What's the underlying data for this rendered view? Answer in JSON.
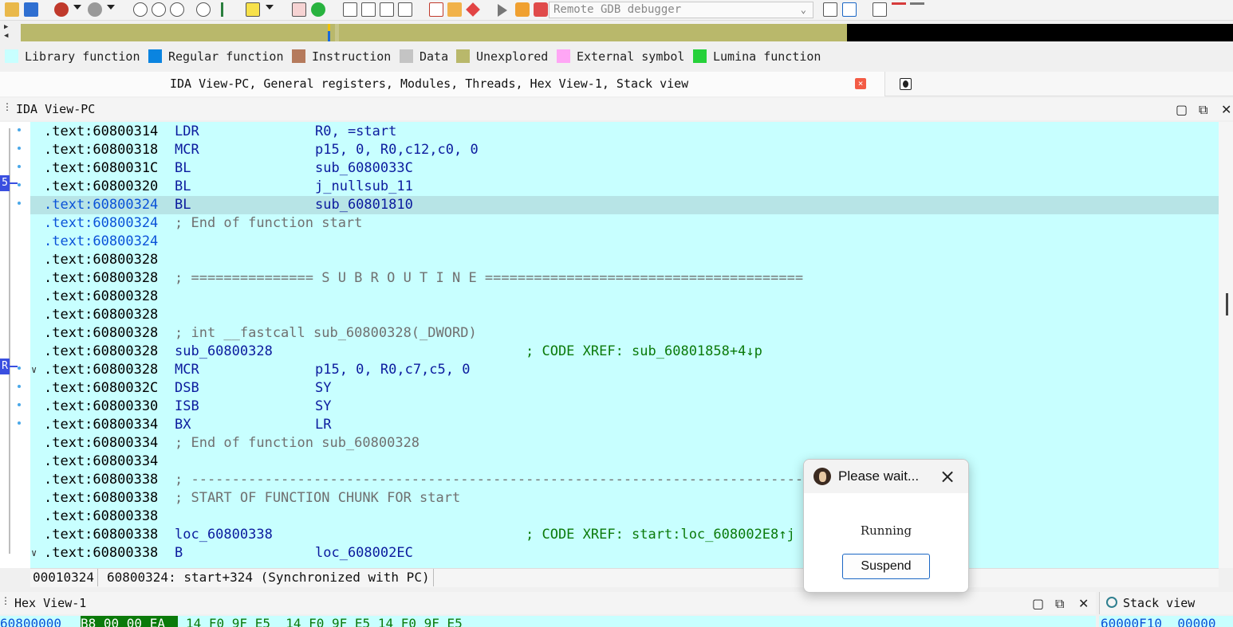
{
  "toolbar": {
    "icons": [
      "open-icon",
      "save-icon",
      "breakpoint-icon",
      "dropdown-icon",
      "bug-icon",
      "dropdown-icon",
      "nav-back-icon",
      "nav-forward-icon",
      "nav-up-icon",
      "jump-icon",
      "jump-to-icon",
      "text-icon",
      "dropdown-icon",
      "debug-stop-icon",
      "debug-go-icon"
    ],
    "debugger_select": "Remote GDB debugger"
  },
  "legend": [
    {
      "label": "Library function",
      "color": "#c8ffff"
    },
    {
      "label": "Regular function",
      "color": "#0a84e0"
    },
    {
      "label": "Instruction",
      "color": "#b57a5c"
    },
    {
      "label": "Data",
      "color": "#c4c4c4"
    },
    {
      "label": "Unexplored",
      "color": "#b9b86b"
    },
    {
      "label": "External symbol",
      "color": "#ffa6f5"
    },
    {
      "label": "Lumina function",
      "color": "#26d13a"
    }
  ],
  "tabs": {
    "active_title": "IDA View-PC, General registers, Modules, Threads, Hex View-1, Stack view",
    "close_glyph": "×"
  },
  "idaview": {
    "title": "IDA View-PC",
    "gutter_markers": [
      "5",
      "R"
    ]
  },
  "disasm": {
    "lines": [
      {
        "addr": ".text:60800314",
        "mn": "LDR",
        "op": "R0, =start"
      },
      {
        "addr": ".text:60800318",
        "mn": "MCR",
        "op": "p15, 0, R0,c12,c0, 0"
      },
      {
        "addr": ".text:6080031C",
        "mn": "BL",
        "op": "sub_6080033C"
      },
      {
        "addr": ".text:60800320",
        "mn": "BL",
        "op": "j_nullsub_11"
      },
      {
        "addr": ".text:60800324",
        "mn": "BL",
        "op": "sub_60801810"
      },
      {
        "addr": ".text:60800324",
        "cm": "; End of function start"
      },
      {
        "addr": ".text:60800324"
      },
      {
        "addr": ".text:60800328"
      },
      {
        "addr": ".text:60800328",
        "cm": "; =============== S U B R O U T I N E ======================================="
      },
      {
        "addr": ".text:60800328"
      },
      {
        "addr": ".text:60800328"
      },
      {
        "addr": ".text:60800328",
        "cm": "; int __fastcall sub_60800328(_DWORD)"
      },
      {
        "addr": ".text:60800328",
        "mn": "sub_60800328",
        "xr": "; CODE XREF: sub_60801858+4↓p"
      },
      {
        "addr": ".text:60800328",
        "mn": "MCR",
        "op": "p15, 0, R0,c7,c5, 0"
      },
      {
        "addr": ".text:6080032C",
        "mn": "DSB",
        "op": "SY"
      },
      {
        "addr": ".text:60800330",
        "mn": "ISB",
        "op": "SY"
      },
      {
        "addr": ".text:60800334",
        "mn": "BX",
        "op": "LR"
      },
      {
        "addr": ".text:60800334",
        "cm": "; End of function sub_60800328"
      },
      {
        "addr": ".text:60800334"
      },
      {
        "addr": ".text:60800338",
        "cm": "; ---------------------------------------------------------------------------"
      },
      {
        "addr": ".text:60800338",
        "cm": "; START OF FUNCTION CHUNK FOR start"
      },
      {
        "addr": ".text:60800338"
      },
      {
        "addr": ".text:60800338",
        "mn": "loc_60800338",
        "xr": "; CODE XREF: start:loc_608002E8↑j"
      },
      {
        "addr": ".text:60800338",
        "mn": "B",
        "op": "loc_608002EC"
      }
    ]
  },
  "status": {
    "offset": "00010324",
    "location": "60800324: start+324 (Synchronized with PC)"
  },
  "hexview": {
    "title": "Hex View-1",
    "addr": "60800000",
    "highlight": "B8 00 00 EA",
    "bytes": "14 F0 9F E5  14 F0 9F E5 14 F0 9F E5"
  },
  "stackview": {
    "title": "Stack view",
    "row": "60000F10  00000"
  },
  "dialog": {
    "title": "Please wait...",
    "message": "Running",
    "button": "Suspend",
    "close_glyph": "×"
  }
}
